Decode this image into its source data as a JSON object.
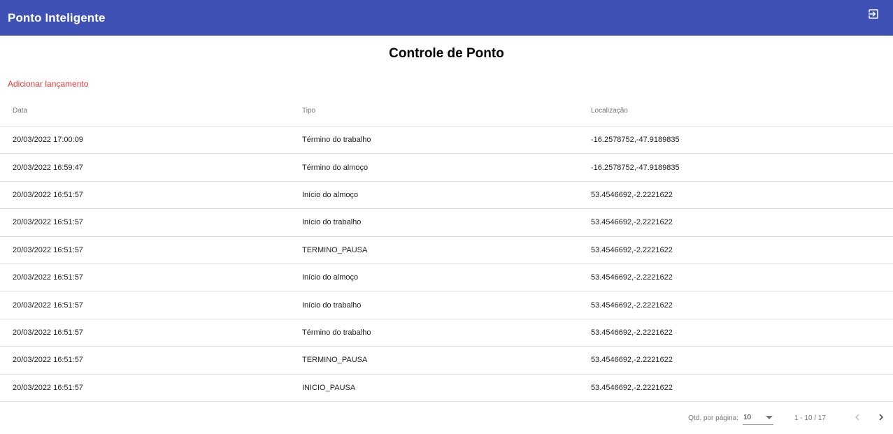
{
  "toolbar": {
    "title": "Ponto Inteligente",
    "logout_icon": "exit-to-app-icon"
  },
  "page": {
    "title": "Controle de Ponto",
    "add_link": "Adicionar lançamento"
  },
  "table": {
    "columns": [
      "Data",
      "Tipo",
      "Localização"
    ],
    "rows": [
      {
        "data": "20/03/2022 17:00:09",
        "tipo": "Término do trabalho",
        "localizacao": "-16.2578752,-47.9189835"
      },
      {
        "data": "20/03/2022 16:59:47",
        "tipo": "Término do almoço",
        "localizacao": "-16.2578752,-47.9189835"
      },
      {
        "data": "20/03/2022 16:51:57",
        "tipo": "Início do almoço",
        "localizacao": "53.4546692,-2.2221622"
      },
      {
        "data": "20/03/2022 16:51:57",
        "tipo": "Início do trabalho",
        "localizacao": "53.4546692,-2.2221622"
      },
      {
        "data": "20/03/2022 16:51:57",
        "tipo": "TERMINO_PAUSA",
        "localizacao": "53.4546692,-2.2221622"
      },
      {
        "data": "20/03/2022 16:51:57",
        "tipo": "Início do almoço",
        "localizacao": "53.4546692,-2.2221622"
      },
      {
        "data": "20/03/2022 16:51:57",
        "tipo": "Início do trabalho",
        "localizacao": "53.4546692,-2.2221622"
      },
      {
        "data": "20/03/2022 16:51:57",
        "tipo": "Término do trabalho",
        "localizacao": "53.4546692,-2.2221622"
      },
      {
        "data": "20/03/2022 16:51:57",
        "tipo": "TERMINO_PAUSA",
        "localizacao": "53.4546692,-2.2221622"
      },
      {
        "data": "20/03/2022 16:51:57",
        "tipo": "INICIO_PAUSA",
        "localizacao": "53.4546692,-2.2221622"
      }
    ]
  },
  "paginator": {
    "page_size_label": "Qtd. por página:",
    "page_size": "10",
    "range_label": "1 - 10 / 17",
    "prev_icon": "chevron-left-icon",
    "next_icon": "chevron-right-icon"
  },
  "colors": {
    "toolbar": "#3f51b5",
    "accent_link": "#e53935"
  }
}
